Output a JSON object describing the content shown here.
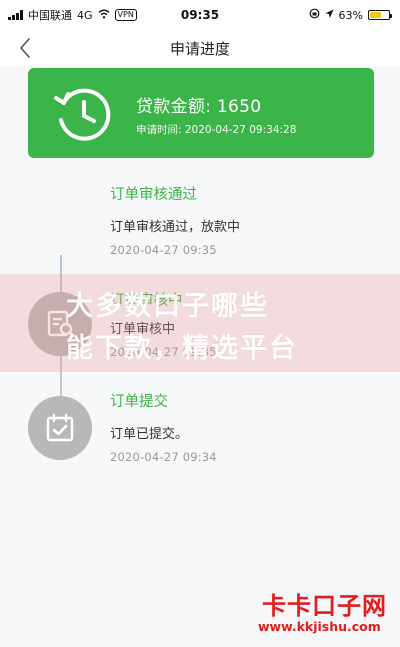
{
  "status_bar": {
    "carrier": "中国联通",
    "network": "4G",
    "vpn": "VPN",
    "time": "09:35",
    "battery_percent": "63%",
    "battery_level": 0.63,
    "icons": [
      "signal-icon",
      "wifi-icon",
      "lock-rotation-icon",
      "location-icon",
      "battery-icon"
    ]
  },
  "nav": {
    "title": "申请进度",
    "back_icon": "chevron-left-icon"
  },
  "summary": {
    "amount_label": "贷款金额: 1650",
    "apply_time": "申请时间: 2020-04-27 09:34:28",
    "icon": "clock-history-icon",
    "color": "#3bb54a"
  },
  "steps": [
    {
      "title": "订单审核通过",
      "desc": "订单审核通过，放款中",
      "time": "2020-04-27 09:35",
      "icon": ""
    },
    {
      "title": "订单审核中",
      "desc": "订单审核中",
      "time": "2020-04-27 09:35",
      "icon": "document-review-icon"
    },
    {
      "title": "订单提交",
      "desc": "订单已提交。",
      "time": "2020-04-27 09:34",
      "icon": "calendar-check-icon"
    }
  ],
  "watermark": {
    "line1": "大多数口子哪些",
    "line2": "能下款，精选平台",
    "brand": "卡卡口子网",
    "url": "www.kkjishu.com"
  },
  "colors": {
    "accent_green": "#3bb54a",
    "icon_gray": "#b8b8b8",
    "brand_red": "#e21d1d"
  }
}
